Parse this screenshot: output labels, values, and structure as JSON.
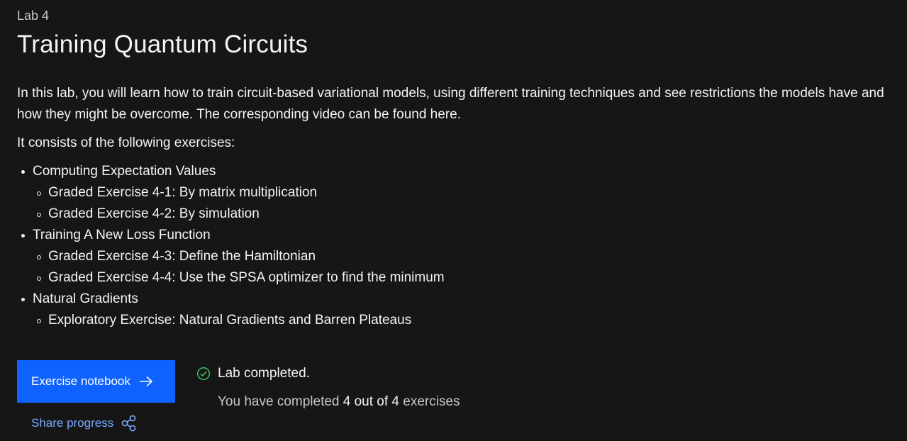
{
  "lab": {
    "eyebrow": "Lab 4",
    "title": "Training Quantum Circuits",
    "intro": "In this lab, you will learn how to train circuit-based variational models, using different training techniques and see restrictions the models have and how they might be overcome. The corresponding video can be found here.",
    "consists": "It consists of the following exercises:"
  },
  "exercises": [
    {
      "label": "Computing Expectation Values",
      "items": [
        "Graded Exercise 4-1: By matrix multiplication",
        "Graded Exercise 4-2: By simulation"
      ]
    },
    {
      "label": "Training A New Loss Function",
      "items": [
        "Graded Exercise 4-3: Define the Hamiltonian",
        "Graded Exercise 4-4: Use the SPSA optimizer to find the minimum"
      ]
    },
    {
      "label": "Natural Gradients",
      "items": [
        "Exploratory Exercise: Natural Gradients and Barren Plateaus"
      ]
    }
  ],
  "actions": {
    "notebook_label": "Exercise notebook",
    "notebook_icon": "arrow-right-icon",
    "share_label": "Share progress",
    "share_icon": "share-icon"
  },
  "status": {
    "icon": "checkmark-outline-icon",
    "label": "Lab completed.",
    "progress_prefix": "You have completed",
    "progress_value": "4 out of 4",
    "progress_suffix": "exercises"
  },
  "colors": {
    "background": "#161616",
    "primary_button": "#0f62fe",
    "link": "#78a9ff",
    "success": "#42be65"
  }
}
